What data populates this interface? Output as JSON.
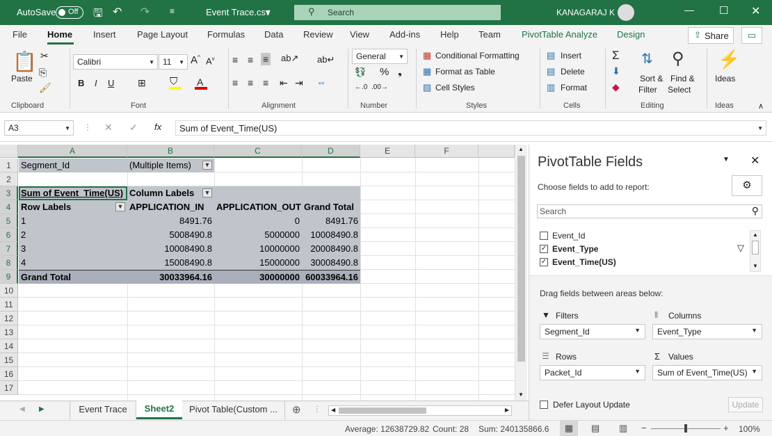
{
  "title_bar": {
    "autosave_label": "AutoSave",
    "autosave_state": "Off",
    "file_name": "Event Trace.csv",
    "search_placeholder": "Search",
    "user_name": "KANAGARAJ K"
  },
  "menu": {
    "tabs": [
      "File",
      "Home",
      "Insert",
      "Page Layout",
      "Formulas",
      "Data",
      "Review",
      "View",
      "Add-ins",
      "Help",
      "Team",
      "PivotTable Analyze",
      "Design"
    ],
    "active_tab": "Home",
    "share_label": "Share"
  },
  "ribbon": {
    "clipboard": {
      "paste": "Paste",
      "label": "Clipboard"
    },
    "font": {
      "name": "Calibri",
      "size": "11",
      "label": "Font",
      "bold": "B",
      "italic": "I",
      "underline": "U"
    },
    "alignment": {
      "label": "Alignment"
    },
    "number": {
      "format": "General",
      "label": "Number"
    },
    "styles": {
      "conditional": "Conditional Formatting",
      "table": "Format as Table",
      "cell": "Cell Styles",
      "label": "Styles"
    },
    "cells": {
      "insert": "Insert",
      "delete": "Delete",
      "format": "Format",
      "label": "Cells"
    },
    "editing": {
      "sort": "Sort &",
      "filter": "Filter",
      "find": "Find &",
      "select": "Select",
      "label": "Editing"
    },
    "ideas": {
      "button": "Ideas",
      "label": "Ideas"
    }
  },
  "formula_bar": {
    "name_box": "A3",
    "fx": "fx",
    "formula": "Sum of Event_Time(US)"
  },
  "grid": {
    "columns": [
      "A",
      "B",
      "C",
      "D",
      "E",
      "F"
    ],
    "rows": [
      "1",
      "2",
      "3",
      "4",
      "5",
      "6",
      "7",
      "8",
      "9",
      "10",
      "11",
      "12",
      "13",
      "14",
      "15",
      "16",
      "17"
    ],
    "filter_label": "Segment_Id",
    "filter_value": "(Multiple Items)",
    "values_header": "Sum of Event_Time(US)",
    "column_labels": "Column Labels",
    "row_labels": "Row Labels",
    "col_headers": [
      "APPLICATION_IN",
      "APPLICATION_OUT",
      "Grand Total"
    ],
    "data": [
      [
        "1",
        "8491.76",
        "0",
        "8491.76"
      ],
      [
        "2",
        "5008490.8",
        "5000000",
        "10008490.8"
      ],
      [
        "3",
        "10008490.8",
        "10000000",
        "20008490.8"
      ],
      [
        "4",
        "15008490.8",
        "15000000",
        "30008490.8"
      ]
    ],
    "grand_total": [
      "Grand Total",
      "30033964.16",
      "30000000",
      "60033964.16"
    ]
  },
  "sheet_tabs": {
    "tabs": [
      "Event Trace",
      "Sheet2",
      "Pivot Table(Custom ..."
    ],
    "active": "Sheet2"
  },
  "status_bar": {
    "average": "Average: 12638729.82",
    "count": "Count: 28",
    "sum": "Sum: 240135866.6",
    "zoom": "100%"
  },
  "pivot_pane": {
    "title": "PivotTable Fields",
    "subtitle": "Choose fields to add to report:",
    "search_placeholder": "Search",
    "fields": [
      {
        "name": "Event_Id",
        "checked": false
      },
      {
        "name": "Event_Type",
        "checked": true
      },
      {
        "name": "Event_Time(US)",
        "checked": true
      }
    ],
    "drag_label": "Drag fields between areas below:",
    "areas": {
      "filters": {
        "label": "Filters",
        "value": "Segment_Id"
      },
      "columns": {
        "label": "Columns",
        "value": "Event_Type"
      },
      "rows": {
        "label": "Rows",
        "value": "Packet_Id"
      },
      "values": {
        "label": "Values",
        "value": "Sum of Event_Time(US)"
      }
    },
    "defer_label": "Defer Layout Update",
    "update_button": "Update"
  }
}
